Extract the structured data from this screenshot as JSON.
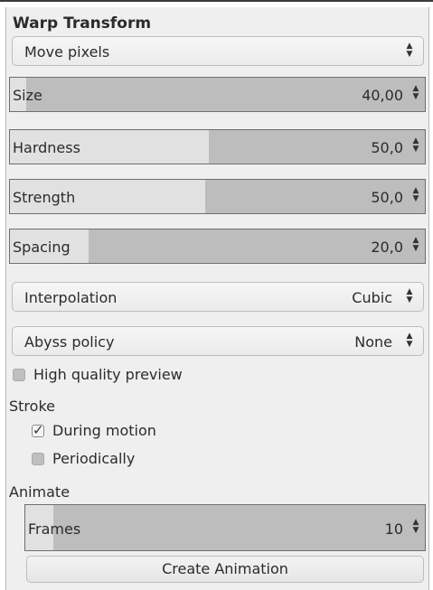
{
  "panel": {
    "title": "Warp Transform",
    "behavior": {
      "value": "Move pixels"
    },
    "spinners": [
      {
        "label": "Size",
        "value": "40,00",
        "fill_fraction": 0.04
      },
      {
        "label": "Hardness",
        "value": "50,0",
        "fill_fraction": 0.5
      },
      {
        "label": "Strength",
        "value": "50,0",
        "fill_fraction": 0.5
      },
      {
        "label": "Spacing",
        "value": "20,0",
        "fill_fraction": 0.2
      }
    ],
    "interpolation": {
      "label": "Interpolation",
      "value": "Cubic"
    },
    "abyss_policy": {
      "label": "Abyss policy",
      "value": "None"
    },
    "high_quality_preview": {
      "label": "High quality preview",
      "checked": false
    },
    "stroke": {
      "label": "Stroke",
      "during_motion": {
        "label": "During motion",
        "checked": true
      },
      "periodically": {
        "label": "Periodically",
        "checked": false
      }
    },
    "animate": {
      "label": "Animate",
      "frames": {
        "label": "Frames",
        "value": "10",
        "fill_fraction": 0.07
      },
      "create_button": "Create Animation"
    }
  },
  "icons": {
    "updown": "updown-arrows-icon",
    "check": "checkmark-icon"
  },
  "colors": {
    "panel_bg": "#efefef",
    "spin_fill": "#e1e1e1",
    "spin_track": "#bdbdbd"
  }
}
